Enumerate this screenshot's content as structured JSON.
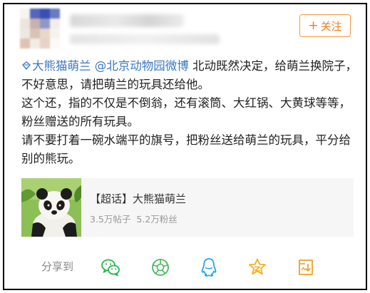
{
  "header": {
    "follow_label": "关注",
    "follow_plus": "+",
    "accent_color": "#f47b1a"
  },
  "post": {
    "topic": "大熊猫萌兰",
    "mention": "@北京动物园微博",
    "line1_rest": " 北动既然决定，给萌兰换院子，不好意思，请把萌兰的玩具还给他。",
    "para2": "这个还，指的不仅是不倒翁，还有滚筒、大红锅、大黄球等等，粉丝赠送的所有玩具。",
    "para3": "请不要打着一碗水端平的旗号，把粉丝送给萌兰的玩具，平分给别的熊玩。",
    "link_color": "#3a77c4"
  },
  "card": {
    "title": "【超话】大熊猫萌兰",
    "posts": "3.5万帖子",
    "fans": "5.2万粉丝"
  },
  "actions": {
    "share_label": "分享到",
    "icons": [
      "wechat-icon",
      "moments-icon",
      "qq-icon",
      "qzone-icon",
      "save-image-icon"
    ]
  }
}
